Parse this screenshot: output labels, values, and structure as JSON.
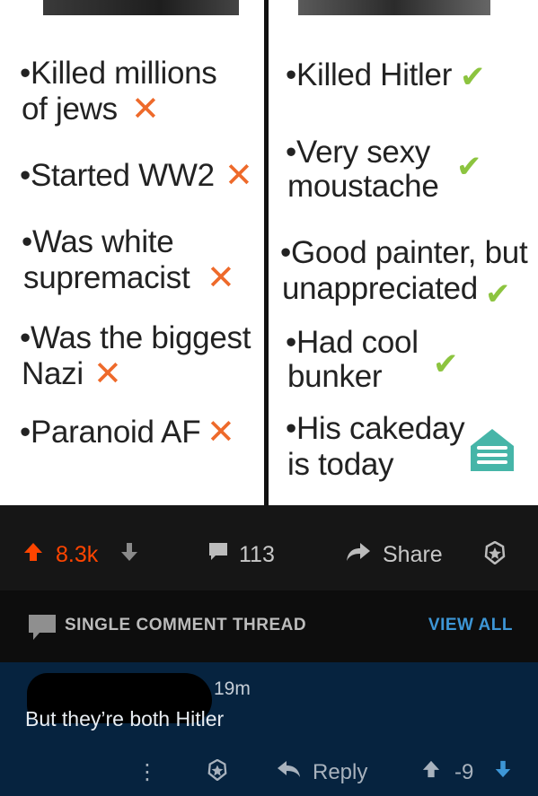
{
  "meme": {
    "left_items": [
      {
        "line1": "•Killed millions",
        "line2": "of jews",
        "mark": "✕"
      },
      {
        "line1": "•Started WW2",
        "mark": "✕"
      },
      {
        "line1": "•Was white",
        "line2": "supremacist",
        "mark": "✕"
      },
      {
        "line1": "•Was the biggest",
        "line2": "Nazi",
        "mark": "✕"
      },
      {
        "line1": "•Paranoid AF",
        "mark": "✕"
      }
    ],
    "right_items": [
      {
        "line1": "•Killed Hitler",
        "mark": "✔"
      },
      {
        "line1": "•Very sexy",
        "line2": "moustache",
        "mark": "✔"
      },
      {
        "line1": "•Good painter, but",
        "line2": "unappreciated",
        "mark": "✔"
      },
      {
        "line1": "•Had cool",
        "line2": "bunker",
        "mark": "✔"
      },
      {
        "line1": "•His cakeday",
        "line2": "is today"
      }
    ],
    "colors": {
      "cross": "#ee6a2b",
      "check": "#8cc43f",
      "cake": "#46b5a8"
    }
  },
  "actions": {
    "score": "8.3k",
    "comments": "113",
    "share": "Share",
    "icons": [
      "upvote-arrow-icon",
      "downvote-arrow-icon",
      "comment-bubble-icon",
      "share-arrow-icon",
      "award-icon"
    ]
  },
  "thread": {
    "label": "SINGLE COMMENT THREAD",
    "view_all": "VIEW ALL"
  },
  "comment": {
    "time": "19m",
    "body": "But they’re both Hitler",
    "more": "⋮",
    "reply": "Reply",
    "score": "-9"
  }
}
